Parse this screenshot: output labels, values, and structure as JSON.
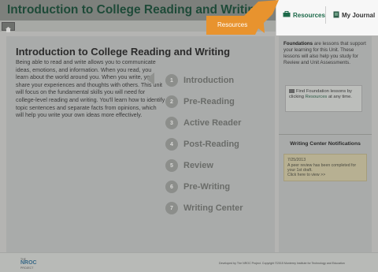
{
  "header": {
    "title": "Introduction to College Reading and Writing",
    "tabs": [
      {
        "label": "Resources",
        "icon": "resources-icon"
      },
      {
        "label": "My Journal",
        "icon": "journal-icon"
      }
    ]
  },
  "callout": {
    "label": "Resources",
    "color": "#e8932e"
  },
  "main": {
    "title": "Introduction to College Reading and Writing",
    "intro": "Being able to read and write allows you to communicate ideas, emotions, and information. When you read, you learn about the world around you. When you write, you share your experiences and thoughts with others. This unit will focus on the fundamental skills you will need for college-level reading and writing. You'll learn how to identify topic sentences and separate facts from opinions, which will help you write your own ideas more effectively.",
    "units": [
      {
        "number": "1",
        "label": "Introduction"
      },
      {
        "number": "2",
        "label": "Pre-Reading"
      },
      {
        "number": "3",
        "label": "Active Reader"
      },
      {
        "number": "4",
        "label": "Post-Reading"
      },
      {
        "number": "5",
        "label": "Review"
      },
      {
        "number": "6",
        "label": "Pre-Writing"
      },
      {
        "number": "7",
        "label": "Writing Center"
      }
    ]
  },
  "sidebar": {
    "foundations_bold": "Foundations",
    "foundations_text": " are lessons that support your learning for this Unit. These lessons will also help you study for Review and Unit Assessments.",
    "find_text_1": "Find Foundation lessons by clicking ",
    "find_link": "Resources",
    "find_text_2": " at any time.",
    "wc_title": "Writing Center Notifications",
    "wc_date": "7/25/2013",
    "wc_message": "A peer review has been completed for your 1st draft.",
    "wc_link": "Click here to view >>"
  },
  "footer": {
    "logo_text": "NROC",
    "logo_top": "THE",
    "logo_bottom": "PROJECT",
    "copyright": "Developed by The NROC Project. Copyright ©2015 Monterey Institute for Technology and Education"
  },
  "colors": {
    "title_green": "#1e4a38",
    "accent_orange": "#e8932e",
    "resources_green": "#1d6a4a"
  }
}
